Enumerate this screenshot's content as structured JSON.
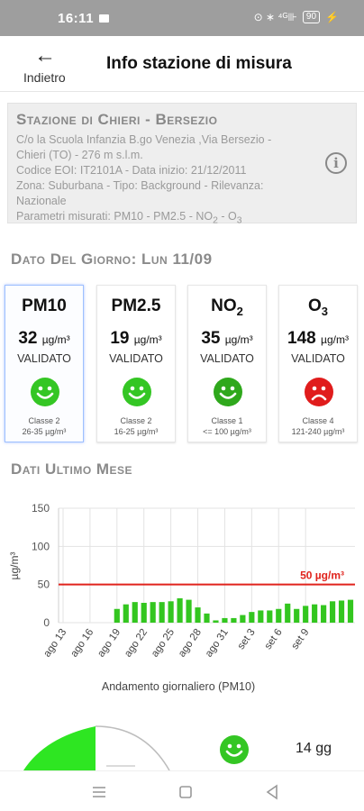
{
  "status_bar": {
    "time": "16:11",
    "icons": "⊙ ∗ ⁴ᴳ⊪",
    "battery": "90"
  },
  "app_bar": {
    "back_label": "Indietro",
    "title": "Info stazione di misura"
  },
  "station": {
    "name": "Stazione di Chieri - Bersezio",
    "address_line1": "C/o la Scuola Infanzia B.go Venezia ,Via Bersezio -",
    "address_line2": "Chieri (TO) - 276 m s.l.m.",
    "code_line": "Codice EOI: IT2101A - Data inizio: 21/12/2011",
    "zone_line1": "Zona: Suburbana - Tipo: Background - Rilevanza:",
    "zone_line2": "Nazionale",
    "params_prefix": "Parametri misurati: PM10 - PM2.5 - NO",
    "params_sub1": "2",
    "params_sep": " - O",
    "params_sub2": "3",
    "info_icon": "info-icon"
  },
  "day_section": {
    "title": "Dato Del Giorno: Lun 11/09"
  },
  "cards": [
    {
      "param": "PM10",
      "sub": "",
      "value": "32",
      "unit": "µg/m³",
      "status": "VALIDATO",
      "face": "happy",
      "color": "#34c624",
      "class_label": "Classe 2",
      "class_range": "26-35 µg/m³"
    },
    {
      "param": "PM2.5",
      "sub": "",
      "value": "19",
      "unit": "µg/m³",
      "status": "VALIDATO",
      "face": "happy",
      "color": "#34c624",
      "class_label": "Classe 2",
      "class_range": "16-25 µg/m³"
    },
    {
      "param": "NO",
      "sub": "2",
      "value": "35",
      "unit": "µg/m³",
      "status": "VALIDATO",
      "face": "happy",
      "color": "#2fa81c",
      "class_label": "Classe 1",
      "class_range": "<= 100 µg/m³"
    },
    {
      "param": "O",
      "sub": "3",
      "value": "148",
      "unit": "µg/m³",
      "status": "VALIDATO",
      "face": "sad",
      "color": "#e01c1c",
      "class_label": "Classe 4",
      "class_range": "121-240 µg/m³"
    }
  ],
  "month_section": {
    "title": "Dati Ultimo Mese"
  },
  "chart_data": {
    "type": "bar",
    "ylabel": "µg/m³",
    "xlabel": "Andamento giornaliero (PM10)",
    "ylim": [
      0,
      150
    ],
    "yticks": [
      0,
      50,
      100,
      150
    ],
    "xtick_labels": [
      "ago 13",
      "ago 16",
      "ago 19",
      "ago 22",
      "ago 25",
      "ago 28",
      "ago 31",
      "set 3",
      "set 6",
      "set 9"
    ],
    "threshold": {
      "value": 50,
      "label": "50 µg/m³",
      "color": "#e0231c"
    },
    "bar_color": "#33c61f",
    "values": [
      null,
      null,
      null,
      null,
      null,
      null,
      18,
      24,
      27,
      26,
      27,
      27,
      28,
      32,
      30,
      20,
      12,
      3,
      6,
      6,
      10,
      14,
      16,
      16,
      18,
      25,
      18,
      22,
      24,
      23,
      28,
      29,
      30
    ]
  },
  "summary": {
    "days": "14 gg",
    "gauge_color": "#2ee622"
  }
}
